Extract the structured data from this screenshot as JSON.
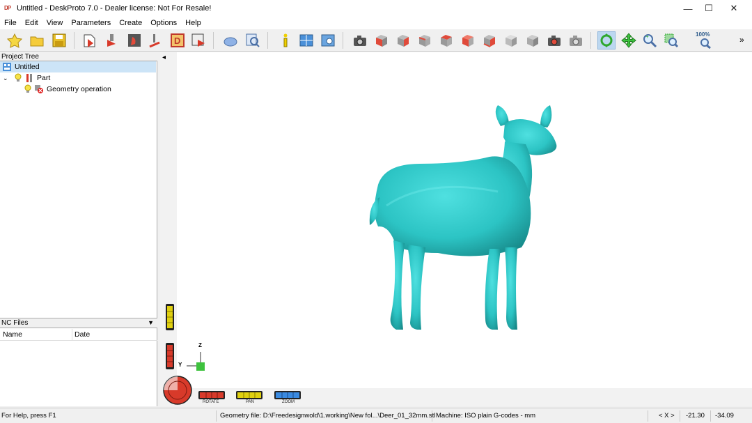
{
  "window": {
    "title": "Untitled - DeskProto 7.0 - Dealer license: Not For Resale!",
    "app_icon_text": "DP",
    "minimize_glyph": "—",
    "maximize_glyph": "☐",
    "close_glyph": "✕"
  },
  "menu": [
    "File",
    "Edit",
    "View",
    "Parameters",
    "Create",
    "Options",
    "Help"
  ],
  "toolbar": {
    "zoom_percent": "100%",
    "more_glyph": "»",
    "tools": [
      "new-project",
      "open-project",
      "save-project",
      "import-geometry",
      "part-parameters",
      "operation-parameters",
      "machining-icon",
      "drawing-icon",
      "save-nc",
      "vector-parameters",
      "zoom-find",
      "info",
      "layout",
      "view-settings",
      "snapshot",
      "view-front",
      "view-right",
      "view-back",
      "view-left",
      "view-top",
      "view-bottom",
      "view-iso",
      "view-default",
      "render",
      "camera-settings",
      "rotate-mode",
      "pan-mode",
      "zoom-mode",
      "zoom-window",
      "zoom-100"
    ]
  },
  "project_tree": {
    "header": "Project Tree",
    "root": "Untitled",
    "part": "Part",
    "operation": "Geometry operation",
    "expand_glyph": "⌄"
  },
  "nc_files": {
    "header": "NC Files",
    "dropdown_glyph": "▼",
    "columns": [
      "Name",
      "Date"
    ]
  },
  "viewport": {
    "collapse_glyph": "◂",
    "model_color": "#3cc8c8",
    "axis_z": "Z",
    "axis_y": "Y",
    "slider_labels": [
      "ROTATE",
      "PAN",
      "ZOOM"
    ]
  },
  "status": {
    "help": "For Help, press F1",
    "geometry_file": "Geometry file: D:\\Freedesignwold\\1.working\\New fol...\\Deer_01_32mm.stl",
    "machine": "Machine: ISO plain G-codes - mm",
    "axis": "< X >",
    "coord_x": "-21.30",
    "coord_y": "-34.09"
  }
}
